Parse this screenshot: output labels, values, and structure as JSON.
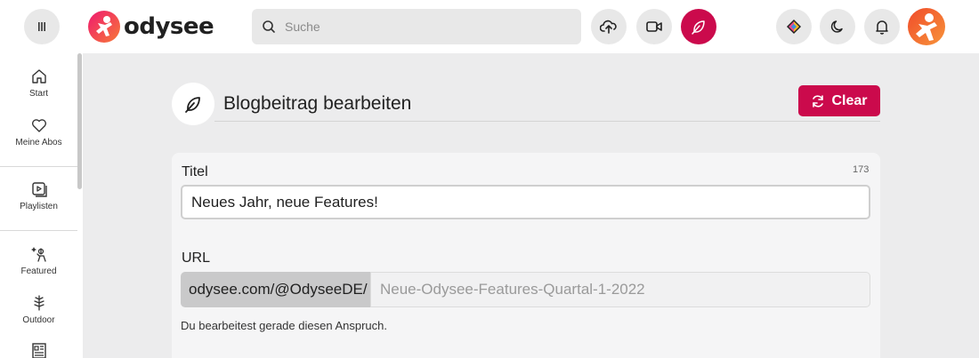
{
  "header": {
    "logo_text": "odysee",
    "search_placeholder": "Suche",
    "buttons": [
      "upload-icon",
      "video-icon",
      "feather-icon",
      "wallet-icon",
      "moon-icon",
      "bell-icon"
    ],
    "accent_color": "#cb0a4c"
  },
  "sidebar": {
    "items": [
      {
        "label": "Start",
        "icon": "home-icon"
      },
      {
        "label": "Meine Abos",
        "icon": "heart-icon"
      },
      {
        "label": "Playlisten",
        "icon": "playlist-icon"
      },
      {
        "label": "Featured",
        "icon": "featured-icon"
      },
      {
        "label": "Outdoor",
        "icon": "tree-icon"
      }
    ]
  },
  "page": {
    "title": "Blogbeitrag bearbeiten",
    "clear_label": "Clear"
  },
  "form": {
    "title_label": "Titel",
    "title_counter": "173",
    "title_value": "Neues Jahr, neue Features!",
    "url_label": "URL",
    "url_prefix": "odysee.com/@OdyseeDE/",
    "url_placeholder": "Neue-Odysee-Features-Quartal-1-2022",
    "hint": "Du bearbeitest gerade diesen Anspruch."
  }
}
